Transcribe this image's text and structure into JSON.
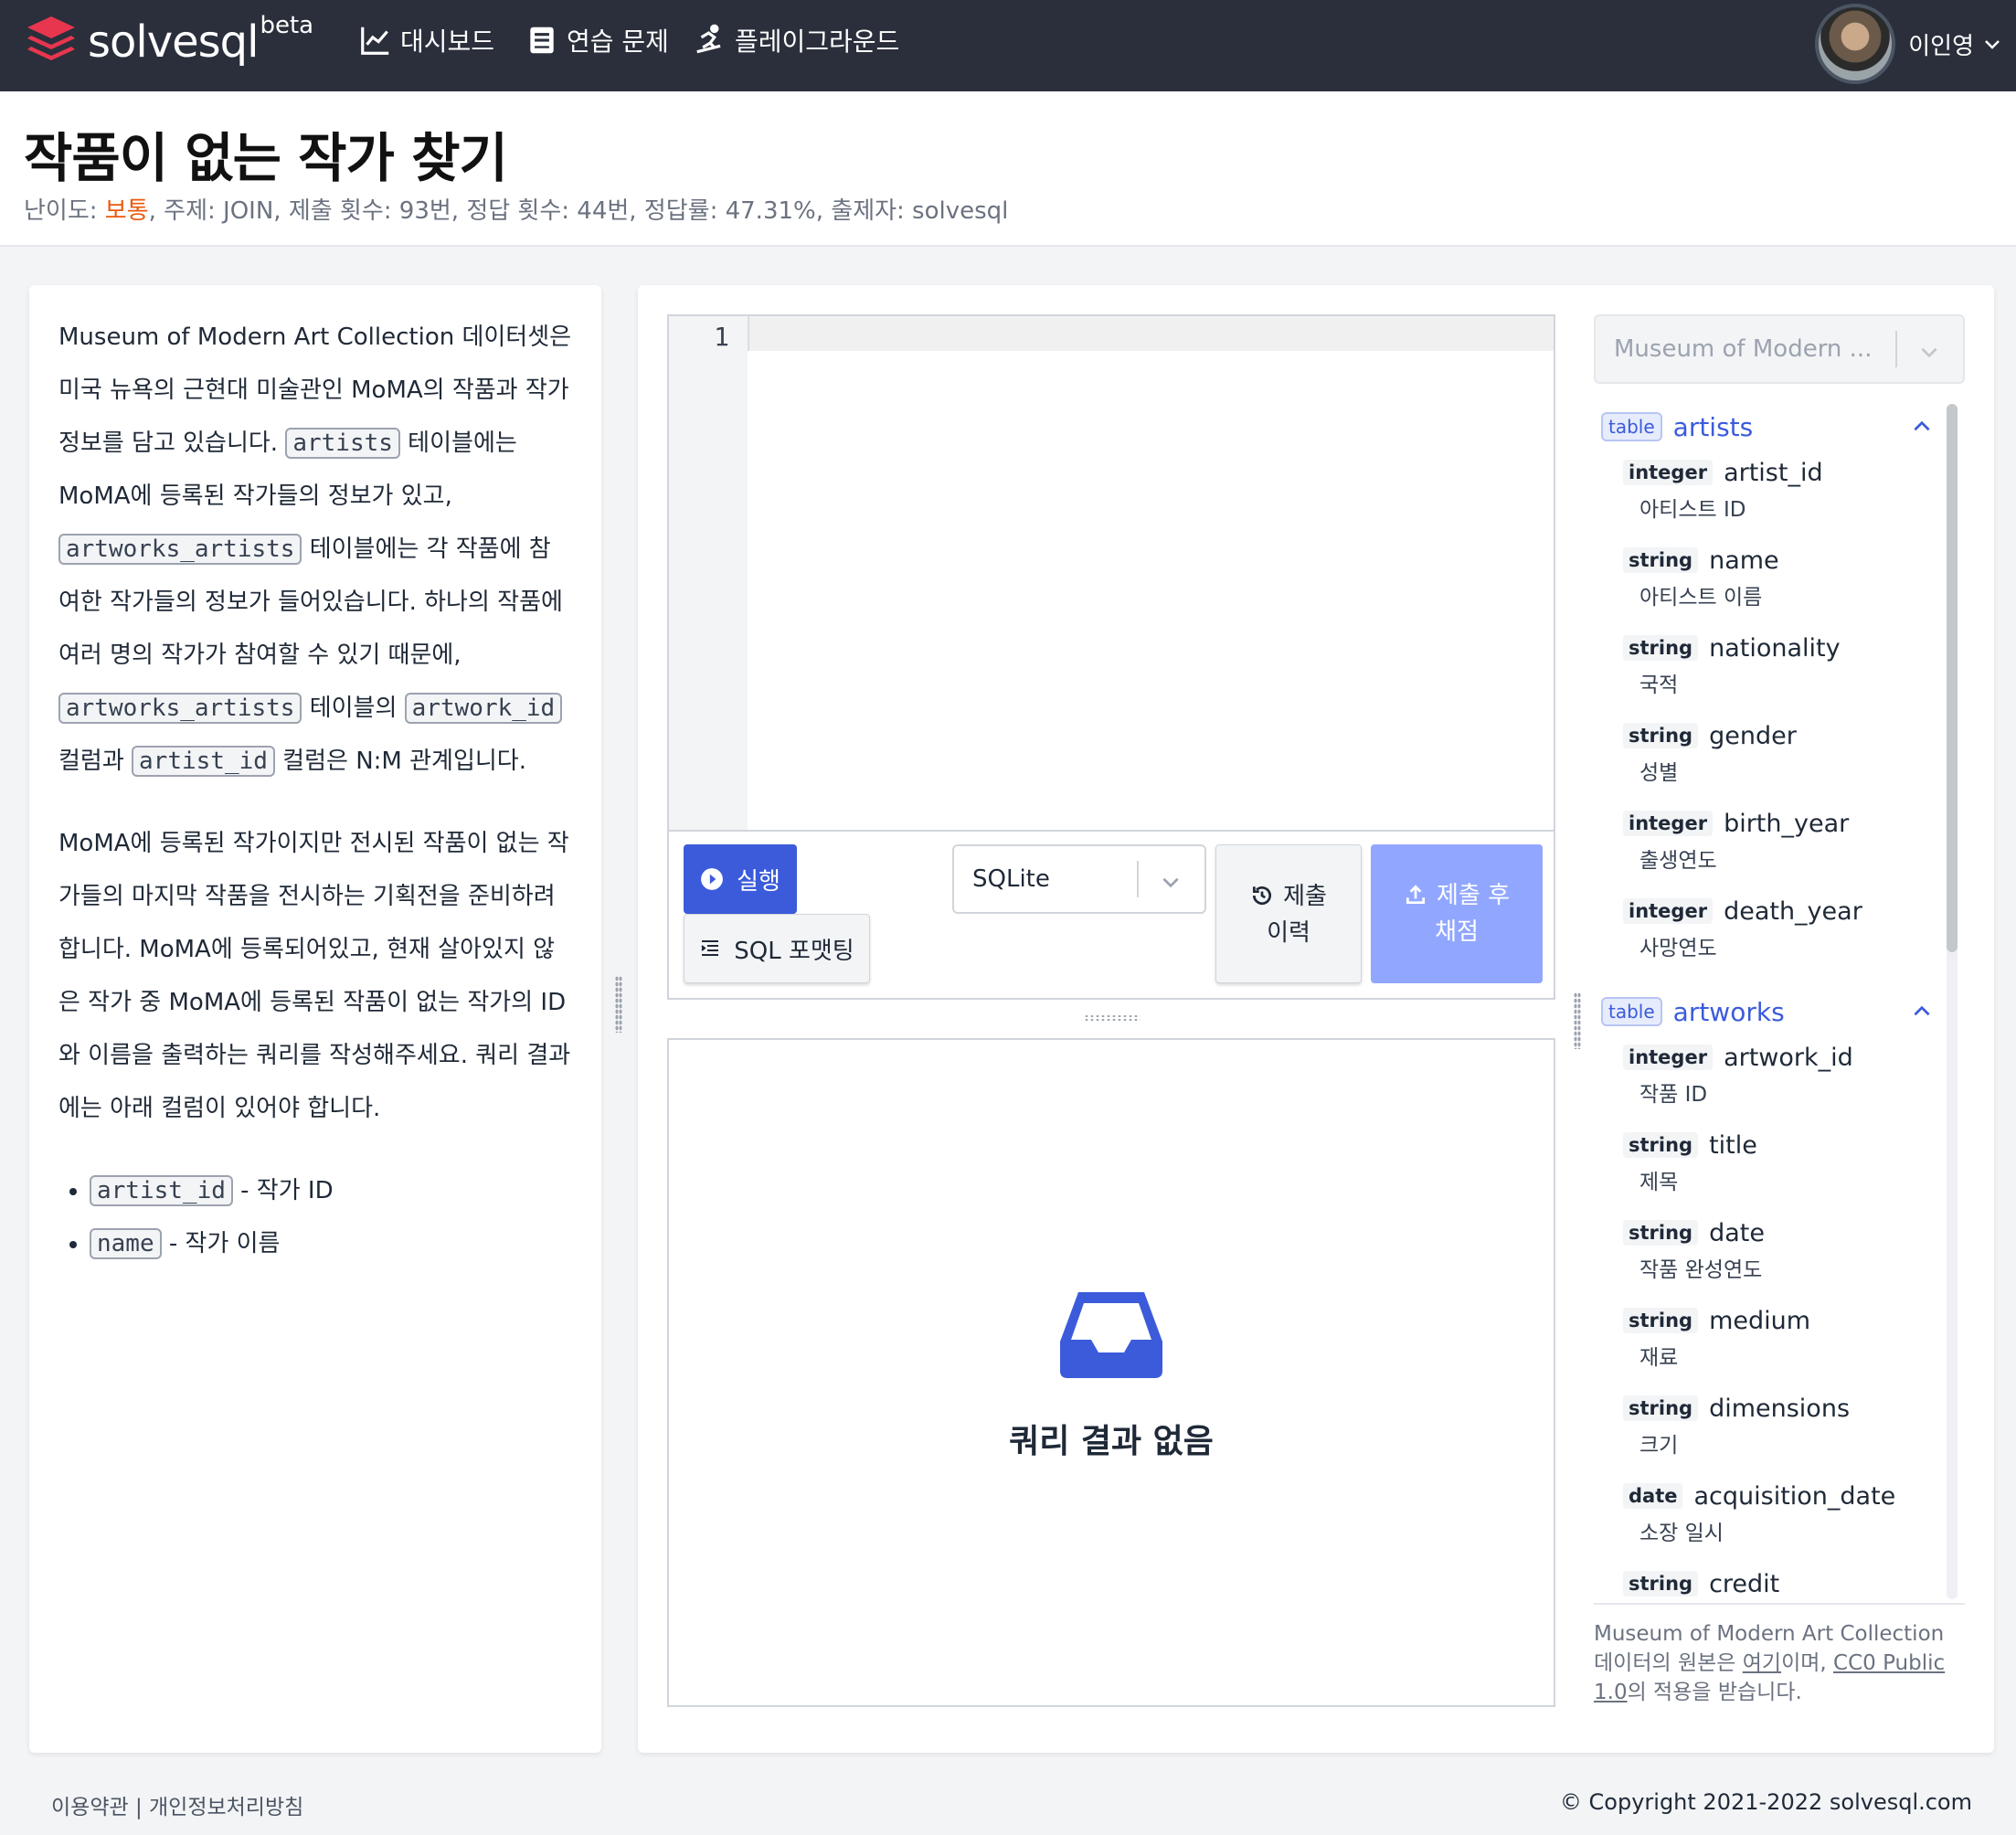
{
  "nav": {
    "logo": "solvesql",
    "beta": "beta",
    "items": [
      {
        "label": "대시보드",
        "icon": "chart-line-icon"
      },
      {
        "label": "연습 문제",
        "icon": "book-icon"
      },
      {
        "label": "플레이그라운드",
        "icon": "skate-icon"
      }
    ],
    "user_name": "이인영"
  },
  "problem": {
    "title": "작품이 없는 작가 찾기",
    "meta_prefix": "난이도: ",
    "level": "보통",
    "meta_rest": ", 주제: JOIN, 제출 횟수: 93번, 정답 횟수: 44번, 정답률: 47.31%, 출제자: solvesql"
  },
  "description": {
    "p1_a": "Museum of Modern Art Collection 데이터셋은 미국 뉴욕의 근현대 미술관인 MoMA의 작품과 작가 정보를 담고 있습니다. ",
    "code_artists": "artists",
    "p1_b": " 테이블에는 MoMA에 등록된 작가들의 정보가 있고, ",
    "code_artworks_artists": "artworks_artists",
    "p1_c": " 테이블에는 각 작품에 참여한 작가들의 정보가 들어있습니다. 하나의 작품에 여러 명의 작가가 참여할 수 있기 때문에, ",
    "code_artworks_artists_2": "artworks_artists",
    "p1_d": " 테이블의 ",
    "code_artwork_id": "artwork_id",
    "p1_e": " 컬럼과 ",
    "code_artist_id": "artist_id",
    "p1_f": " 컬럼은 N:M 관계입니다.",
    "p2": "MoMA에 등록된 작가이지만 전시된 작품이 없는 작가들의 마지막 작품을 전시하는 기획전을 준비하려 합니다. MoMA에 등록되어있고, 현재 살아있지 않은 작가 중 MoMA에 등록된 작품이 없는 작가의 ID와 이름을 출력하는 쿼리를 작성해주세요. 쿼리 결과에는 아래 컬럼이 있어야 합니다.",
    "bullets": [
      {
        "code": "artist_id",
        "text": " - 작가 ID"
      },
      {
        "code": "name",
        "text": " - 작가 이름"
      }
    ]
  },
  "editor": {
    "line_number": "1",
    "run_label": "실행",
    "format_label": "SQL 포맷팅",
    "engine": "SQLite",
    "history_label_1": "제출",
    "history_label_2": "이력",
    "submit_label_1": "제출 후",
    "submit_label_2": "채점",
    "empty_result": "쿼리 결과 없음"
  },
  "schema": {
    "database": "Museum of Modern ...",
    "badge": "table",
    "tables": [
      {
        "name": "artists",
        "columns": [
          {
            "type": "integer",
            "name": "artist_id",
            "desc": "아티스트 ID"
          },
          {
            "type": "string",
            "name": "name",
            "desc": "아티스트 이름"
          },
          {
            "type": "string",
            "name": "nationality",
            "desc": "국적"
          },
          {
            "type": "string",
            "name": "gender",
            "desc": "성별"
          },
          {
            "type": "integer",
            "name": "birth_year",
            "desc": "출생연도"
          },
          {
            "type": "integer",
            "name": "death_year",
            "desc": "사망연도"
          }
        ]
      },
      {
        "name": "artworks",
        "columns": [
          {
            "type": "integer",
            "name": "artwork_id",
            "desc": "작품 ID"
          },
          {
            "type": "string",
            "name": "title",
            "desc": "제목"
          },
          {
            "type": "string",
            "name": "date",
            "desc": "작품 완성연도"
          },
          {
            "type": "string",
            "name": "medium",
            "desc": "재료"
          },
          {
            "type": "string",
            "name": "dimensions",
            "desc": "크기"
          },
          {
            "type": "date",
            "name": "acquisition_date",
            "desc": "소장 일시"
          },
          {
            "type": "string",
            "name": "credit",
            "desc": ""
          }
        ]
      }
    ],
    "footer_a": "Museum of Modern Art Collection 데이터의 원본은 ",
    "footer_link1": "여기",
    "footer_b": "이며, ",
    "footer_link2": "CC0 Public 1.0",
    "footer_c": "의 적용을 받습니다."
  },
  "footer": {
    "left": "이용약관 | 개인정보처리방침",
    "right": "© Copyright 2021-2022 solvesql.com"
  },
  "colors": {
    "nav_bg": "#2a2f3b",
    "accent": "#3b5bdb",
    "submit_disabled": "#91a7ff",
    "level": "#ea580c"
  }
}
